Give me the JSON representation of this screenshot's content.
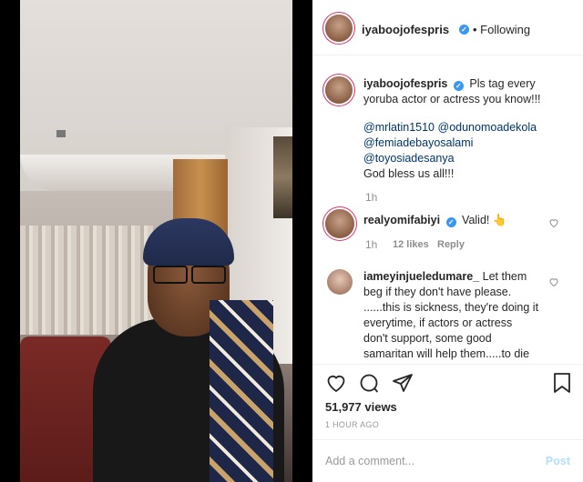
{
  "header": {
    "username": "iyaboojofespris",
    "follow_status": "• Following"
  },
  "caption": {
    "username": "iyaboojofespris",
    "line1": "Pls tag every",
    "line2": "yoruba actor or actress you know!!!",
    "mentions": [
      "@mrlatin1510",
      "@odunomoadekola",
      "@femiadebayosalami",
      "@toyosiadesanya"
    ],
    "closing": "God bless us all!!!",
    "time": "1h"
  },
  "comments": [
    {
      "username": "realyomifabiyi",
      "text": "Valid! 👆",
      "time": "1h",
      "likes": "12 likes",
      "reply": "Reply"
    },
    {
      "username": "iameyinjueledumare_",
      "text_lines": [
        "Let them",
        "beg if they don't have please.",
        "......this is sickness, they're doing it",
        "everytime, if actors or actress",
        "don't support, some good",
        "samaritan will help them.....to die"
      ]
    }
  ],
  "stats": {
    "views": "51,977 views",
    "time_ago": "1 HOUR AGO"
  },
  "footer": {
    "placeholder": "Add a comment...",
    "post_label": "Post"
  },
  "icons": {
    "like": "heart-icon",
    "comment": "comment-icon",
    "share": "share-icon",
    "save": "bookmark-icon"
  },
  "colors": {
    "verified": "#3897f0",
    "mention": "#003569",
    "muted": "#8e8e8e",
    "post_disabled": "#b2dffc"
  }
}
